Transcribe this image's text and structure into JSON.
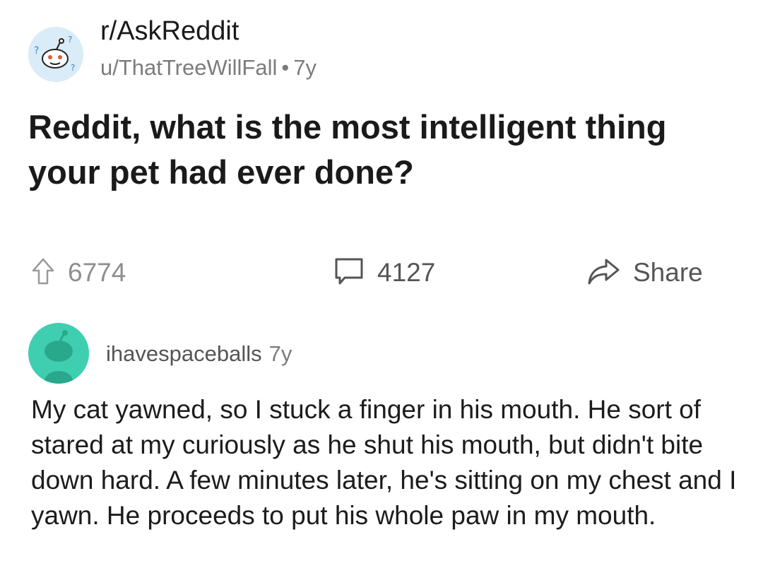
{
  "post": {
    "subreddit": "r/AskReddit",
    "author": "u/ThatTreeWillFall",
    "separator": "•",
    "age": "7y",
    "title": "Reddit, what is the most intelligent thing your pet had ever done?"
  },
  "actions": {
    "upvote_count": "6774",
    "comment_count": "4127",
    "share_label": "Share"
  },
  "comment": {
    "username": "ihavespaceballs",
    "age": "7y",
    "body": "My cat yawned, so I stuck a finger in his mouth. He sort of stared at my curiously as he shut his mouth, but didn't bite down hard. A few minutes later, he's sitting on my chest and I yawn. He proceeds to put his whole paw in my mouth."
  },
  "icons": {
    "subreddit_avatar": "askreddit-snoo-icon",
    "upvote": "upvote-arrow-icon",
    "comments": "comment-bubble-icon",
    "share": "share-arrow-icon",
    "user_avatar": "snoo-avatar-icon"
  },
  "colors": {
    "subreddit_avatar_bg": "#d9ecf7",
    "user_avatar_bg": "#3fcfb0",
    "user_avatar_figure": "#2aa88c",
    "muted_text": "#7c7c7c"
  }
}
